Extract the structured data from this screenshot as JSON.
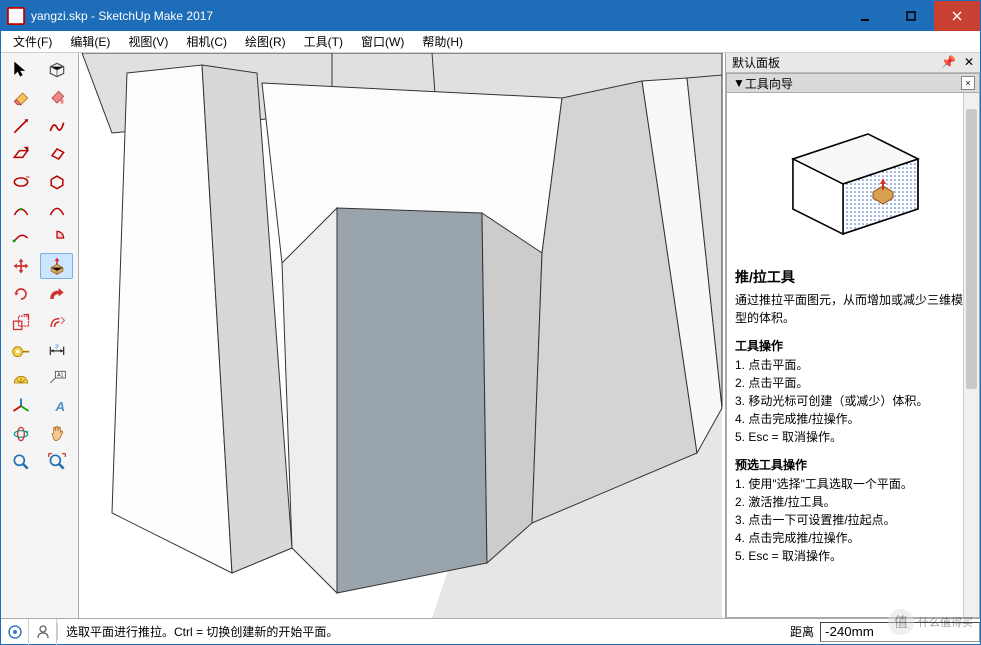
{
  "title": "yangzi.skp - SketchUp Make 2017",
  "menu": {
    "file": "文件(F)",
    "edit": "编辑(E)",
    "view": "视图(V)",
    "camera": "相机(C)",
    "draw": "绘图(R)",
    "tool": "工具(T)",
    "window": "窗口(W)",
    "help": "帮助(H)"
  },
  "tray": {
    "title": "默认面板",
    "panel_title": "工具向导",
    "instructor": {
      "tool_name": "推/拉工具",
      "tool_desc": "通过推拉平面图元，从而增加或减少三维模型的体积。",
      "op_title": "工具操作",
      "op1": "1. 点击平面。",
      "op2": "2. 点击平面。",
      "op3": "3. 移动光标可创建（或减少）体积。",
      "op4": "4. 点击完成推/拉操作。",
      "op5": "5. Esc = 取消操作。",
      "pre_title": "预选工具操作",
      "pre1": "1. 使用\"选择\"工具选取一个平面。",
      "pre2": "2. 激活推/拉工具。",
      "pre3": "3. 点击一下可设置推/拉起点。",
      "pre4": "4. 点击完成推/拉操作。",
      "pre5": "5. Esc = 取消操作。"
    }
  },
  "status": {
    "hint": "选取平面进行推拉。Ctrl = 切换创建新的开始平面。",
    "dist_label": "距离",
    "dist_value": "-240mm"
  },
  "viewport": {
    "dimtext": ""
  },
  "watermark": "什么值得买"
}
